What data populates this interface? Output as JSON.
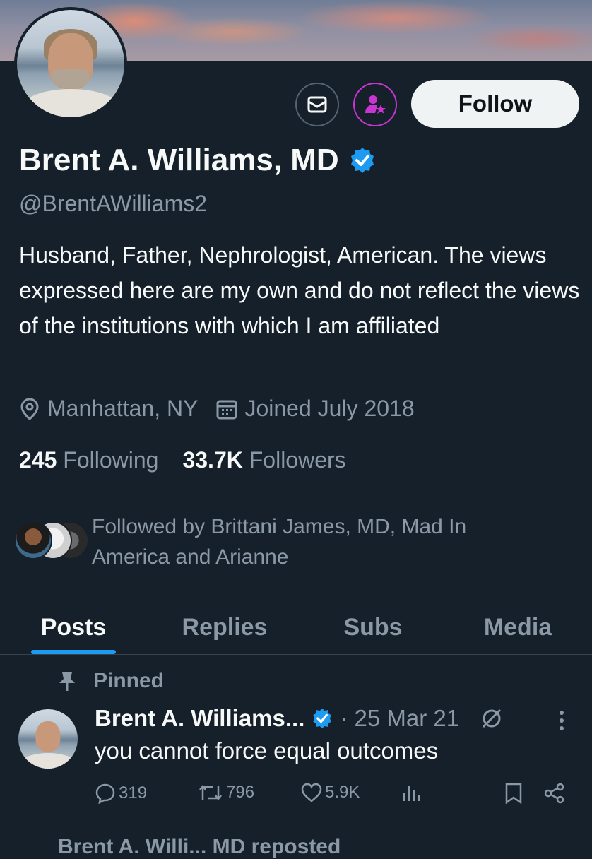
{
  "profile": {
    "name": "Brent A. Williams, MD",
    "handle": "@BrentAWilliams2",
    "bio": "Husband, Father, Nephrologist, American.  The views expressed here are my own and do not reflect the views of the institutions with which I am affiliated",
    "location": "Manhattan, NY",
    "joined": "Joined July 2018",
    "following_count": "245",
    "following_label": "Following",
    "followers_count": "33.7K",
    "followers_label": "Followers",
    "followed_by": "Followed by Brittani James, MD, Mad In America and Arianne",
    "follow_button": "Follow"
  },
  "tabs": [
    "Posts",
    "Replies",
    "Subs",
    "Media"
  ],
  "active_tab": "Posts",
  "pinned_post": {
    "pinned_label": "Pinned",
    "author": "Brent A. Williams...",
    "date": "· 25 Mar 21",
    "text": "you cannot force equal outcomes",
    "replies": "319",
    "reposts": "796",
    "likes": "5.9K"
  },
  "next_post_partial": "Brent A. Willi...  MD reposted",
  "colors": {
    "background": "#15202b",
    "accent": "#1d9bf0",
    "subscribe_accent": "#c936cf",
    "muted_text": "#8b98a5"
  },
  "icons": [
    "mail-icon",
    "subscribe-icon",
    "verified-badge-icon",
    "location-icon",
    "calendar-icon",
    "pin-icon",
    "grok-icon",
    "more-icon",
    "reply-icon",
    "repost-icon",
    "like-icon",
    "views-icon",
    "bookmark-icon",
    "share-icon"
  ]
}
